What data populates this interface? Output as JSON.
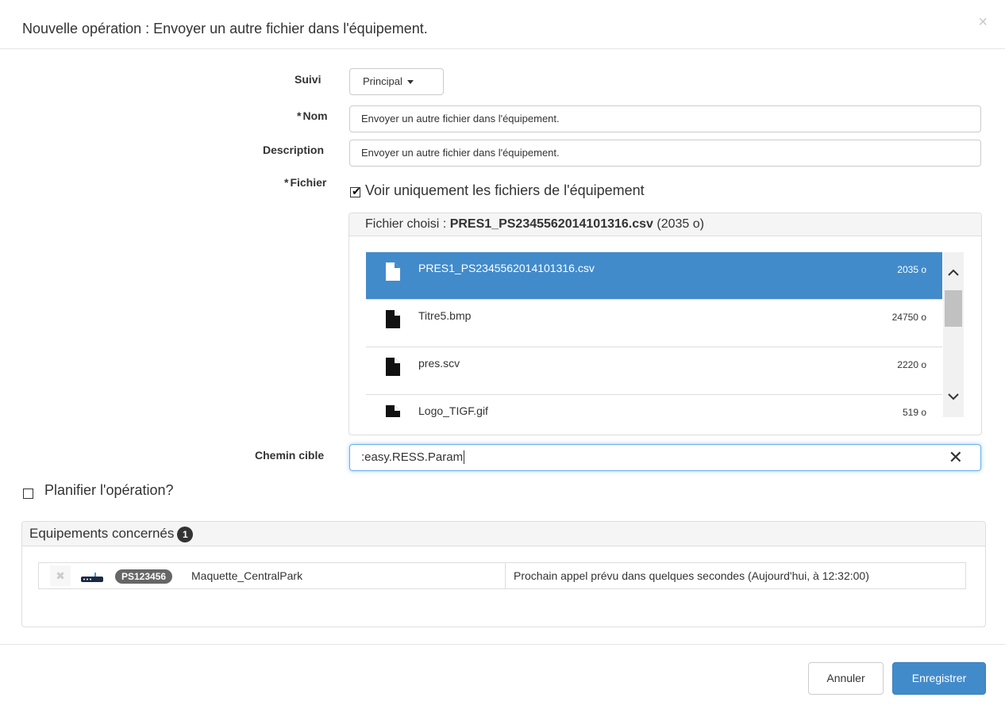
{
  "modal": {
    "title": "Nouvelle opération : Envoyer un autre fichier dans l'équipement.",
    "close_glyph": "×"
  },
  "form": {
    "suivi": {
      "label": "Suivi",
      "value": "Principal"
    },
    "nom": {
      "required_mark": "*",
      "label": "Nom",
      "value": "Envoyer un autre fichier dans l'équipement."
    },
    "description": {
      "label": "Description",
      "value": "Envoyer un autre fichier dans l'équipement."
    },
    "fichier": {
      "required_mark": "*",
      "label": "Fichier",
      "only_device_files_label": "Voir uniquement les fichiers de l'équipement",
      "only_device_files_checked": true,
      "chosen_prefix": "Fichier choisi : ",
      "chosen_name": "PRES1_PS2345562014101316.csv",
      "chosen_size": "(2035 o)",
      "files": [
        {
          "name": "PRES1_PS2345562014101316.csv",
          "size": "2035 o",
          "selected": true
        },
        {
          "name": "Titre5.bmp",
          "size": "24750 o",
          "selected": false
        },
        {
          "name": "pres.scv",
          "size": "2220 o",
          "selected": false
        },
        {
          "name": "Logo_TIGF.gif",
          "size": "519 o",
          "selected": false
        }
      ]
    },
    "chemin_cible": {
      "label": "Chemin cible",
      "value": ":easy.RESS.Param",
      "clear_glyph": "✕"
    },
    "planifier": {
      "label": "Planifier l'opération?",
      "checked": false
    }
  },
  "equipements": {
    "title": "Equipements concernés",
    "count": "1",
    "rows": [
      {
        "remove_glyph": "✖",
        "id": "PS123456",
        "name": "Maquette_CentralPark",
        "status": "Prochain appel prévu dans quelques secondes (Aujourd'hui, à 12:32:00)"
      }
    ]
  },
  "footer": {
    "cancel_label": "Annuler",
    "save_label": "Enregistrer"
  },
  "colors": {
    "primary": "#428bca",
    "selected_row": "#428bca",
    "pill": "#666666"
  },
  "icons": {
    "file": "file-icon",
    "device": "device-icon",
    "checkbox": "checkbox-icon"
  }
}
